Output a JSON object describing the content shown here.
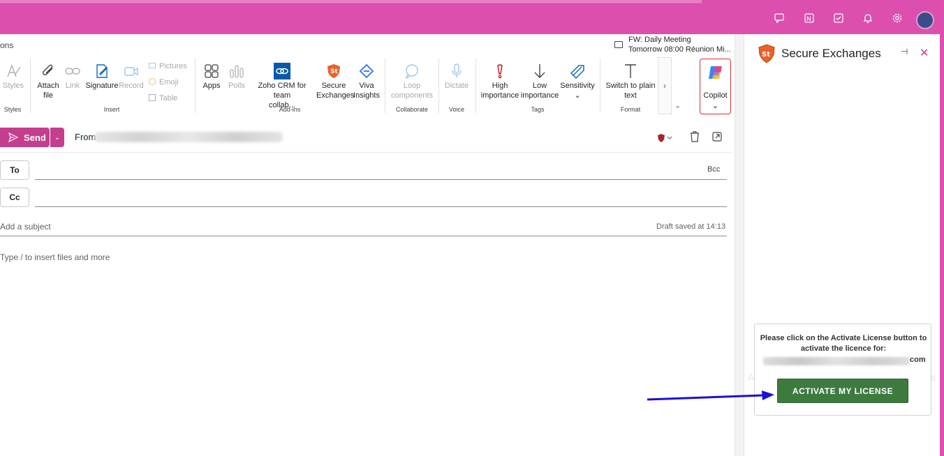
{
  "topbar": {
    "icons": [
      "chat-icon",
      "onenote-icon",
      "tasks-icon",
      "bell-icon",
      "gear-icon"
    ]
  },
  "ribbon": {
    "tab_partial": "ons",
    "meeting": {
      "title": "FW: Daily Meeting",
      "subtitle": "Tomorrow 08:00 Réunion Mi..."
    },
    "groups": {
      "styles": "Styles",
      "insert": "Insert",
      "addins": "Add-ins",
      "collaborate": "Collaborate",
      "voice": "Voice",
      "tags": "Tags",
      "format": "Format"
    },
    "buttons": {
      "styles": "Styles",
      "attach": "Attach file",
      "link": "Link",
      "signature": "Signature",
      "record": "Record",
      "pictures": "Pictures",
      "emoji": "Emoji",
      "table": "Table",
      "apps": "Apps",
      "polls": "Polls",
      "zoho_line1": "Zoho CRM for team",
      "zoho_line2": "collab...",
      "secure_line1": "Secure",
      "secure_line2": "Exchanges",
      "viva_line1": "Viva",
      "viva_line2": "Insights",
      "loop_line1": "Loop",
      "loop_line2": "components",
      "dictate": "Dictate",
      "high_line1": "High",
      "high_line2": "importance",
      "low_line1": "Low",
      "low_line2": "importance",
      "sensitivity": "Sensitivity",
      "plain_line1": "Switch to plain",
      "plain_line2": "text",
      "copilot": "Copilot"
    }
  },
  "compose": {
    "send": "Send",
    "from_label": "From",
    "to": "To",
    "cc": "Cc",
    "bcc": "Bcc",
    "subject_placeholder": "Add a subject",
    "draft_status": "Draft saved at 14:13",
    "body_placeholder": "Type / to insert files and more"
  },
  "panel": {
    "title": "Secure Exchanges",
    "message": "Please click on the Activate License button to activate the licence for:",
    "email_domain": "com",
    "activate_button": "ACTIVATE MY LICENSE",
    "ghost_left": "A",
    "ghost_right": "s"
  },
  "colors": {
    "brand_pink": "#dc4fae",
    "send": "#c43e8e",
    "activate": "#3d7a3e",
    "arrow": "#1a10d8"
  }
}
